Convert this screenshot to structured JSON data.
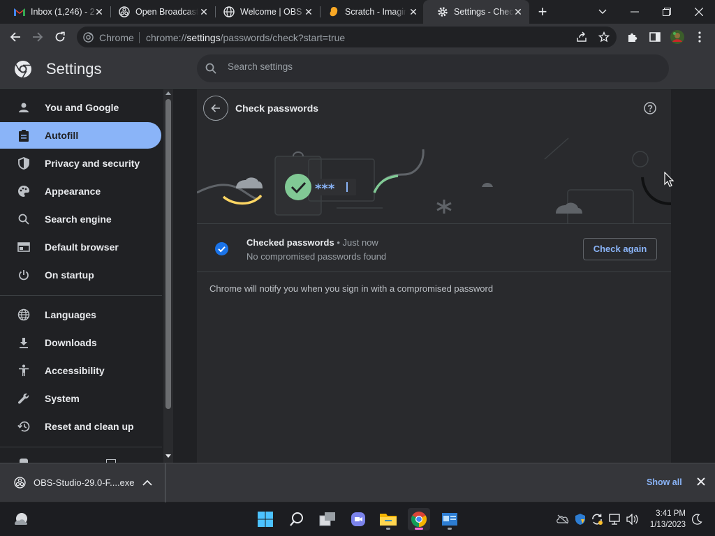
{
  "tabs": [
    {
      "title": "Inbox (1,246) - 2",
      "favicon": "gmail-icon"
    },
    {
      "title": "Open Broadcast",
      "favicon": "obs-icon"
    },
    {
      "title": "Welcome | OBS",
      "favicon": "globe-icon"
    },
    {
      "title": "Scratch - Imagine",
      "favicon": "scratch-icon"
    },
    {
      "title": "Settings - Check",
      "favicon": "gear-icon",
      "active": true
    }
  ],
  "omnibox": {
    "site_label": "Chrome",
    "url_prefix": "chrome://",
    "url_host": "settings",
    "url_path": "/passwords/check?start=true"
  },
  "settings": {
    "title": "Settings",
    "search_placeholder": "Search settings"
  },
  "sidebar": {
    "items": [
      {
        "label": "You and Google",
        "icon": "person-icon"
      },
      {
        "label": "Autofill",
        "icon": "clipboard-icon",
        "active": true
      },
      {
        "label": "Privacy and security",
        "icon": "shield-icon"
      },
      {
        "label": "Appearance",
        "icon": "palette-icon"
      },
      {
        "label": "Search engine",
        "icon": "search-icon"
      },
      {
        "label": "Default browser",
        "icon": "browser-icon"
      },
      {
        "label": "On startup",
        "icon": "power-icon"
      },
      {
        "label": "Languages",
        "icon": "globe-icon"
      },
      {
        "label": "Downloads",
        "icon": "download-icon"
      },
      {
        "label": "Accessibility",
        "icon": "accessibility-icon"
      },
      {
        "label": "System",
        "icon": "wrench-icon"
      },
      {
        "label": "Reset and clean up",
        "icon": "history-icon"
      }
    ]
  },
  "check": {
    "title": "Check passwords",
    "banner_mask": "***",
    "status_title": "Checked passwords",
    "status_time": "• Just now",
    "status_sub": "No compromised passwords found",
    "check_again_label": "Check again",
    "notify_text": "Chrome will notify you when you sign in with a compromised password"
  },
  "download": {
    "filename": "OBS-Studio-29.0-F....exe",
    "show_all_label": "Show all"
  },
  "taskbar": {
    "time": "3:41 PM",
    "date": "1/13/2023"
  },
  "colors": {
    "accent": "#8ab4f8",
    "check_blue": "#1a73e8",
    "banner_green": "#81c995"
  }
}
